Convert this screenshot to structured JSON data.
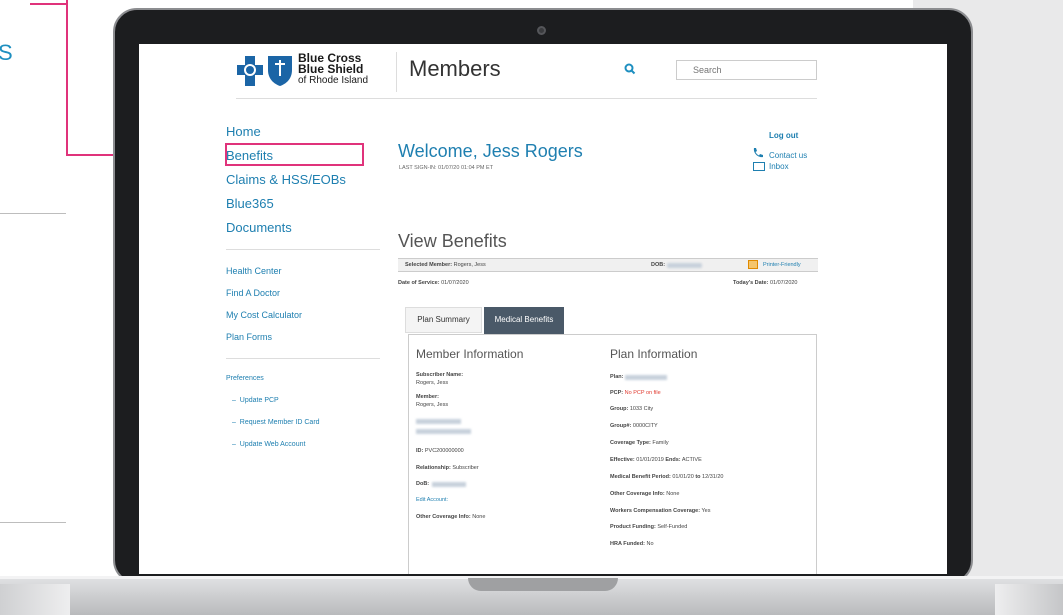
{
  "doc_fragment": {
    "text": "S"
  },
  "logo": {
    "line1": "Blue Cross",
    "line2": "Blue Shield",
    "line3": "of Rhode Island"
  },
  "header": {
    "title": "Members",
    "search_placeholder": "Search"
  },
  "nav": {
    "items": [
      "Home",
      "Benefits",
      "Claims & HSS/EOBs",
      "Blue365",
      "Documents"
    ],
    "secondary": [
      "Health Center",
      "Find A Doctor",
      "My Cost Calculator",
      "Plan Forms"
    ],
    "preferences_label": "Preferences",
    "preferences": [
      "Update PCP",
      "Request Member ID Card",
      "Update Web Account"
    ]
  },
  "welcome": {
    "title": "Welcome, Jess Rogers",
    "last_signin": "LAST SIGN-IN: 01/07/20 01:04 PM ET"
  },
  "top_links": {
    "logout": "Log out",
    "contact": "Contact us",
    "inbox": "Inbox"
  },
  "benefits": {
    "title": "View Benefits",
    "selected_label": "Selected Member:",
    "selected_value": "Rogers, Jess",
    "dob_label": "DOB:",
    "printer": "Printer-Friendly",
    "dos_label": "Date of Service:",
    "dos_value": "01/07/2020",
    "today_label": "Today's Date:",
    "today_value": "01/07/2020",
    "tabs": [
      "Plan Summary",
      "Medical Benefits"
    ]
  },
  "member_info": {
    "title": "Member Information",
    "subscriber_label": "Subscriber Name:",
    "subscriber_value": "Rogers, Jess",
    "member_label": "Member:",
    "member_value": "Rogers, Jess",
    "id_label": "ID:",
    "id_value": "PVC200000000",
    "relationship_label": "Relationship:",
    "relationship_value": "Subscriber",
    "dob_label": "DoB:",
    "edit_account": "Edit Account:",
    "other_label": "Other Coverage Info:",
    "other_value": "None"
  },
  "plan_info": {
    "title": "Plan Information",
    "plan_label": "Plan:",
    "pcp_label": "PCP:",
    "pcp_value": "No PCP on file",
    "group_label": "Group:",
    "group_value": "1033 City",
    "groupno_label": "Group#:",
    "groupno_value": "0000CITY",
    "coverage_label": "Coverage Type:",
    "coverage_value": "Family",
    "effective_label": "Effective:",
    "effective_value": "01/01/2019",
    "ends_label": "Ends:",
    "ends_value": "ACTIVE",
    "period_label": "Medical Benefit Period:",
    "period_value_start": "01/01/20",
    "period_to": "to",
    "period_value_end": "12/31/20",
    "other_label": "Other Coverage Info:",
    "other_value": "None",
    "workers_label": "Workers Compensation Coverage:",
    "workers_value": "Yes",
    "funding_label": "Product Funding:",
    "funding_value": "Self-Funded",
    "hra_label": "HRA Funded:",
    "hra_value": "No"
  },
  "colors": {
    "accent": "#1e8fc0",
    "callout": "#e0337b",
    "brand_blue": "#1b65a6",
    "tab_active": "#4a5968",
    "alert": "#e03a2f"
  }
}
